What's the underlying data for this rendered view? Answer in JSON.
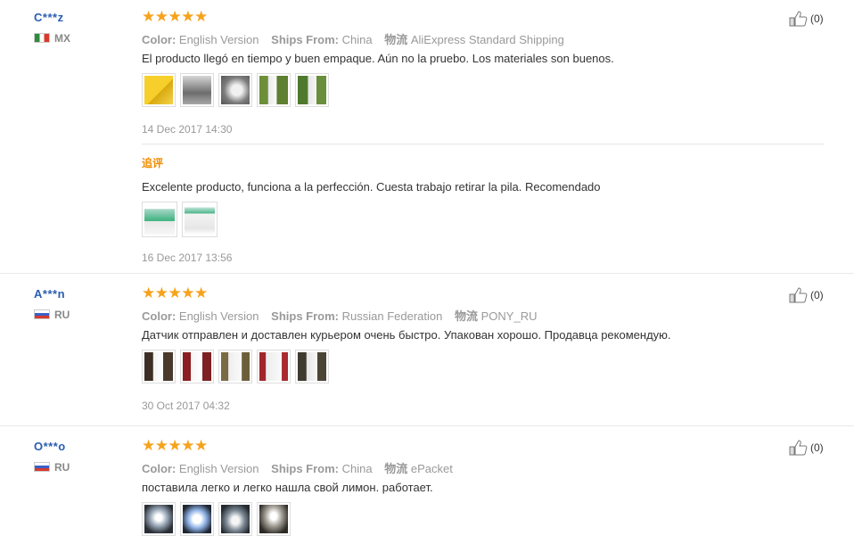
{
  "reviews": [
    {
      "user": "C***z",
      "country": "MX",
      "stars": "★★★★★",
      "color_label": "Color:",
      "color_value": "English Version",
      "ships_label": "Ships From:",
      "ships_value": "China",
      "logistics_label": "物流",
      "logistics_value": "AliExpress Standard Shipping",
      "text": "El producto llegó en tiempo y buen empaque. Aún no la pruebo. Los materiales son buenos.",
      "date": "14 Dec 2017 14:30",
      "likes": "(0)",
      "additional": {
        "label": "追评",
        "text": "Excelente producto, funciona a la perfección. Cuesta trabajo retirar la pila. Recomendado",
        "date": "16 Dec 2017 13:56"
      }
    },
    {
      "user": "A***n",
      "country": "RU",
      "stars": "★★★★★",
      "color_label": "Color:",
      "color_value": "English Version",
      "ships_label": "Ships From:",
      "ships_value": "Russian Federation",
      "logistics_label": "物流",
      "logistics_value": "PONY_RU",
      "text": "Датчик отправлен и доставлен курьером очень быстро. Упакован хорошо. Продавца рекомендую.",
      "date": "30 Oct 2017 04:32",
      "likes": "(0)"
    },
    {
      "user": "O***o",
      "country": "RU",
      "stars": "★★★★★",
      "color_label": "Color:",
      "color_value": "English Version",
      "ships_label": "Ships From:",
      "ships_value": "China",
      "logistics_label": "物流",
      "logistics_value": "ePacket",
      "text": "поставила легко и легко нашла свой лимон. работает.",
      "likes": "(0)"
    }
  ],
  "icons": {
    "like": "thumbs-up-icon",
    "star": "star-icon",
    "flag_mx": "mexico-flag-icon",
    "flag_ru": "russia-flag-icon"
  },
  "colors": {
    "star": "#f6a21c",
    "username": "#2a5db0",
    "additional_label": "#f08c00"
  }
}
